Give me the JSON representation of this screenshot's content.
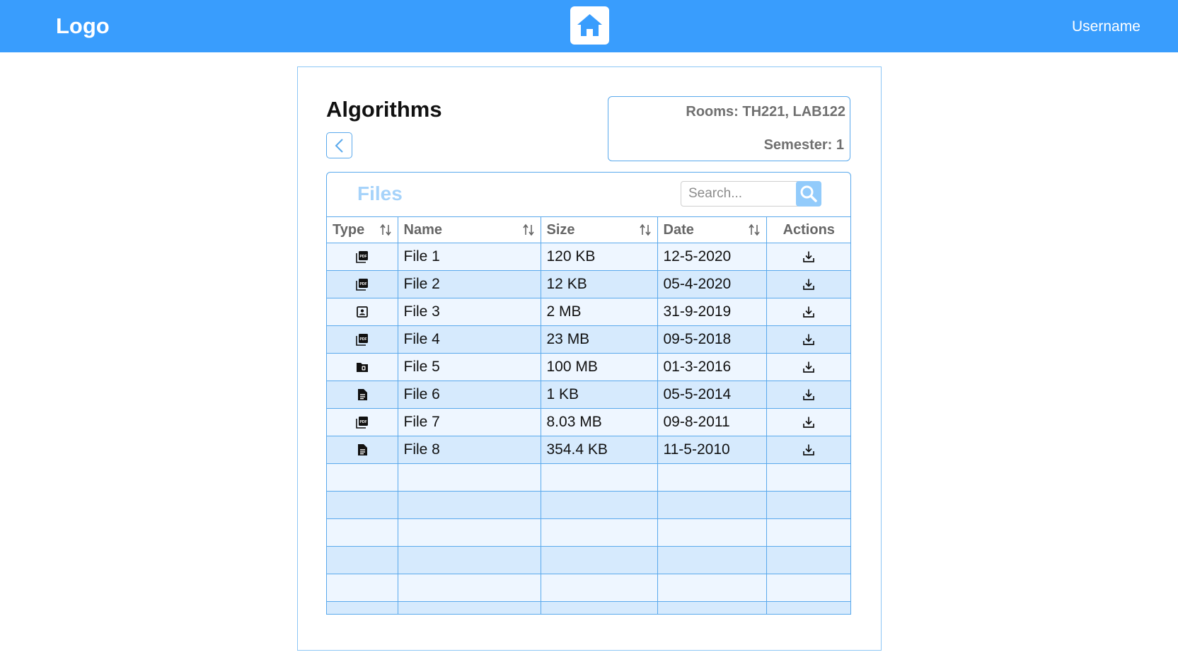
{
  "header": {
    "logo": "Logo",
    "home_icon": "home-icon",
    "username": "Username",
    "bg_color": "#399dfd"
  },
  "course": {
    "title": "Algorithms",
    "back_icon": "chevron-left-icon",
    "rooms": "Rooms: TH221, LAB122",
    "semester": "Semester: 1"
  },
  "files": {
    "title": "Files",
    "search": {
      "placeholder": "Search...",
      "value": "",
      "icon": "search-icon"
    },
    "columns": [
      "Type",
      "Name",
      "Size",
      "Date",
      "Actions"
    ],
    "sortable_columns": [
      "Type",
      "Name",
      "Size",
      "Date"
    ],
    "rows": [
      {
        "type_icon": "pdf-icon",
        "name": "File 1",
        "size": "120 KB",
        "date": "12-5-2020",
        "action_icon": "download-icon"
      },
      {
        "type_icon": "pdf-icon",
        "name": "File 2",
        "size": "12 KB",
        "date": "05-4-2020",
        "action_icon": "download-icon"
      },
      {
        "type_icon": "image-icon",
        "name": "File 3",
        "size": "2 MB",
        "date": "31-9-2019",
        "action_icon": "download-icon"
      },
      {
        "type_icon": "pdf-icon",
        "name": "File 4",
        "size": "23 MB",
        "date": "09-5-2018",
        "action_icon": "download-icon"
      },
      {
        "type_icon": "folder-icon",
        "name": "File 5",
        "size": "100 MB",
        "date": "01-3-2016",
        "action_icon": "download-icon"
      },
      {
        "type_icon": "document-icon",
        "name": "File 6",
        "size": "1 KB",
        "date": "05-5-2014",
        "action_icon": "download-icon"
      },
      {
        "type_icon": "pdf-icon",
        "name": "File 7",
        "size": "8.03 MB",
        "date": "09-8-2011",
        "action_icon": "download-icon"
      },
      {
        "type_icon": "document-icon",
        "name": "File 8",
        "size": "354.4 KB",
        "date": "11-5-2010",
        "action_icon": "download-icon"
      }
    ],
    "row_colors": {
      "odd": "#eef6ff",
      "even": "#d6eafd"
    },
    "accent_color": "#5aa9ec"
  }
}
